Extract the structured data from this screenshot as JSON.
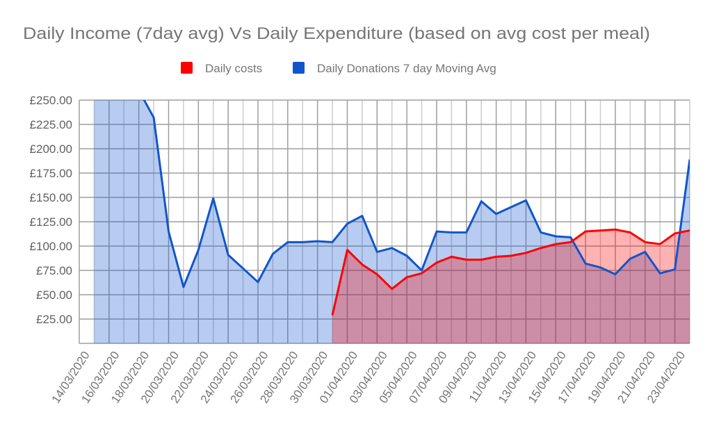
{
  "chart_data": {
    "type": "area",
    "title": "Daily Income (7day avg) Vs Daily Expenditure (based on avg cost per meal)",
    "xlabel": "",
    "ylabel": "",
    "ylim": [
      0,
      250
    ],
    "grid": true,
    "legend_position": "top",
    "y_ticks": [
      "£25.00",
      "£50.00",
      "£75.00",
      "£100.00",
      "£125.00",
      "£150.00",
      "£175.00",
      "£200.00",
      "£225.00",
      "£250.00"
    ],
    "y_tick_values": [
      25,
      50,
      75,
      100,
      125,
      150,
      175,
      200,
      225,
      250
    ],
    "x_tick_labels": [
      "14/03/2020",
      "16/03/2020",
      "18/03/2020",
      "20/03/2020",
      "22/03/2020",
      "24/03/2020",
      "26/03/2020",
      "28/03/2020",
      "30/03/2020",
      "01/04/2020",
      "03/04/2020",
      "05/04/2020",
      "07/04/2020",
      "09/04/2020",
      "11/04/2020",
      "13/04/2020",
      "15/04/2020",
      "17/04/2020",
      "19/04/2020",
      "21/04/2020",
      "23/04/2020"
    ],
    "x": [
      "14/03/2020",
      "15/03/2020",
      "16/03/2020",
      "17/03/2020",
      "18/03/2020",
      "19/03/2020",
      "20/03/2020",
      "21/03/2020",
      "22/03/2020",
      "23/03/2020",
      "24/03/2020",
      "25/03/2020",
      "26/03/2020",
      "27/03/2020",
      "28/03/2020",
      "29/03/2020",
      "30/03/2020",
      "31/03/2020",
      "01/04/2020",
      "02/04/2020",
      "03/04/2020",
      "04/04/2020",
      "05/04/2020",
      "06/04/2020",
      "07/04/2020",
      "08/04/2020",
      "09/04/2020",
      "10/04/2020",
      "11/04/2020",
      "12/04/2020",
      "13/04/2020",
      "14/04/2020",
      "15/04/2020",
      "16/04/2020",
      "17/04/2020",
      "18/04/2020",
      "19/04/2020",
      "20/04/2020",
      "21/04/2020",
      "22/04/2020",
      "23/04/2020"
    ],
    "series": [
      {
        "name": "Daily costs",
        "color": "#ff0000",
        "values": [
          null,
          null,
          null,
          null,
          null,
          null,
          null,
          null,
          null,
          null,
          null,
          null,
          null,
          null,
          null,
          null,
          29,
          96,
          81,
          71,
          56,
          68,
          72,
          83,
          89,
          86,
          86,
          89,
          90,
          93,
          98,
          102,
          104,
          115,
          116,
          117,
          114,
          104,
          102,
          113,
          116
        ]
      },
      {
        "name": "Daily Donations 7 day Moving Avg",
        "color": "#1155cc",
        "values": [
          300,
          300,
          300,
          300,
          232,
          115,
          58,
          96,
          149,
          91,
          77,
          63,
          92,
          104,
          104,
          105,
          104,
          123,
          131,
          94,
          98,
          90,
          75,
          115,
          114,
          114,
          146,
          133,
          140,
          147,
          114,
          110,
          109,
          82,
          78,
          71,
          87,
          94,
          72,
          76,
          189
        ]
      }
    ]
  }
}
